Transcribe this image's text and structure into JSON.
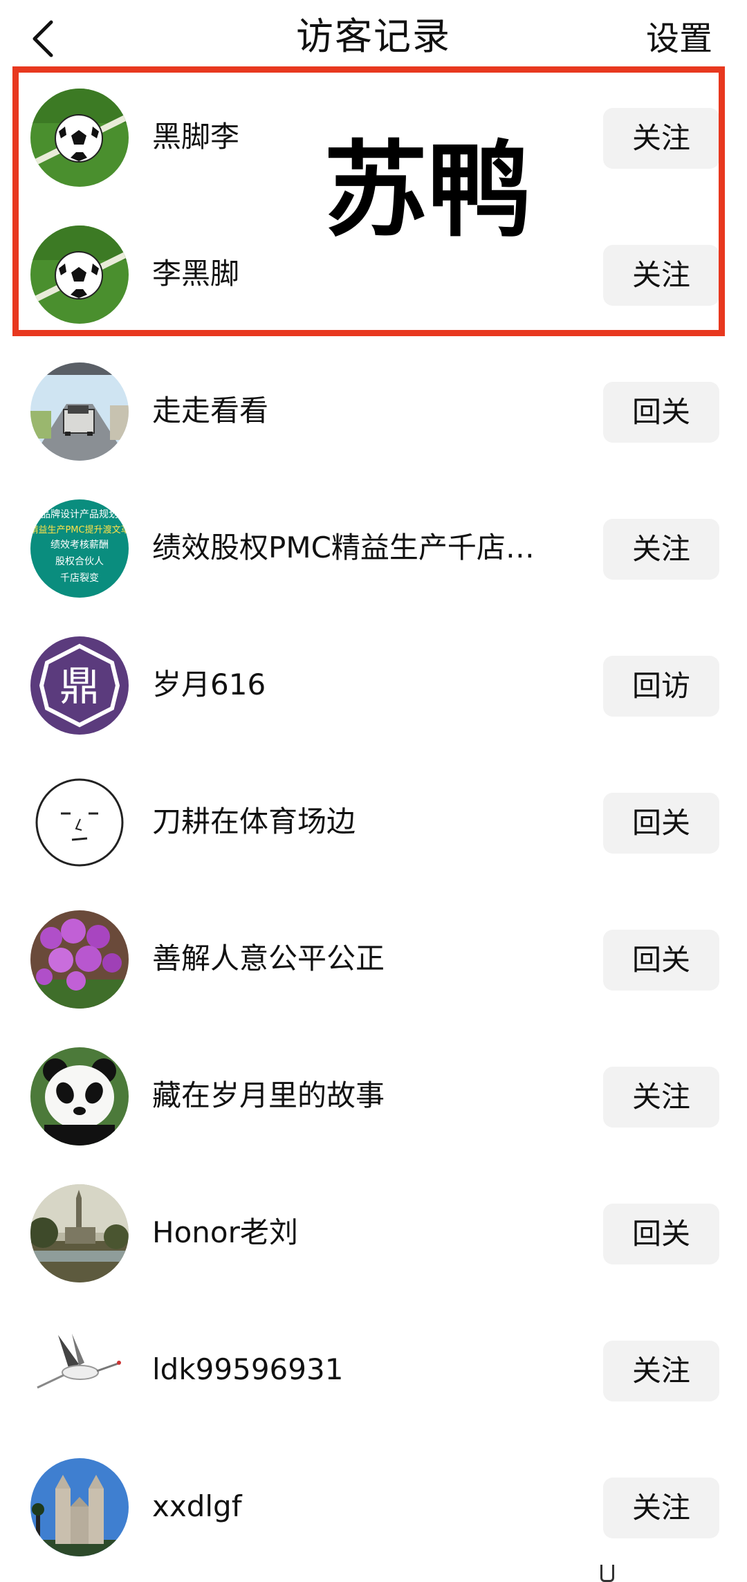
{
  "header": {
    "title": "访客记录",
    "settings_label": "设置"
  },
  "annotation": {
    "watermark_text": "苏鸭"
  },
  "visitors": [
    {
      "name": "黑脚李",
      "action": "关注"
    },
    {
      "name": "李黑脚",
      "action": "关注"
    },
    {
      "name": "走走看看",
      "action": "回关"
    },
    {
      "name": "绩效股权PMC精益生产千店…",
      "action": "关注"
    },
    {
      "name": "岁月616",
      "action": "回访"
    },
    {
      "name": "刀耕在体育场边",
      "action": "回关"
    },
    {
      "name": "善解人意公平公正",
      "action": "回关"
    },
    {
      "name": "藏在岁月里的故事",
      "action": "关注"
    },
    {
      "name": "Honor老刘",
      "action": "回关"
    },
    {
      "name": "ldk99596931",
      "action": "关注"
    },
    {
      "name": "xxdlgf",
      "action": "关注"
    }
  ],
  "avatar_texts": {
    "ad_line1": "品牌设计产品规划",
    "ad_line2": "精益生产PMC提升渡文革",
    "ad_line3": "绩效考核薪酬",
    "ad_line4": "股权合伙人",
    "ad_line5": "千店裂变",
    "seal_char": "鼎"
  },
  "colors": {
    "highlight_border": "#e8381f",
    "button_bg": "#f2f2f2"
  }
}
